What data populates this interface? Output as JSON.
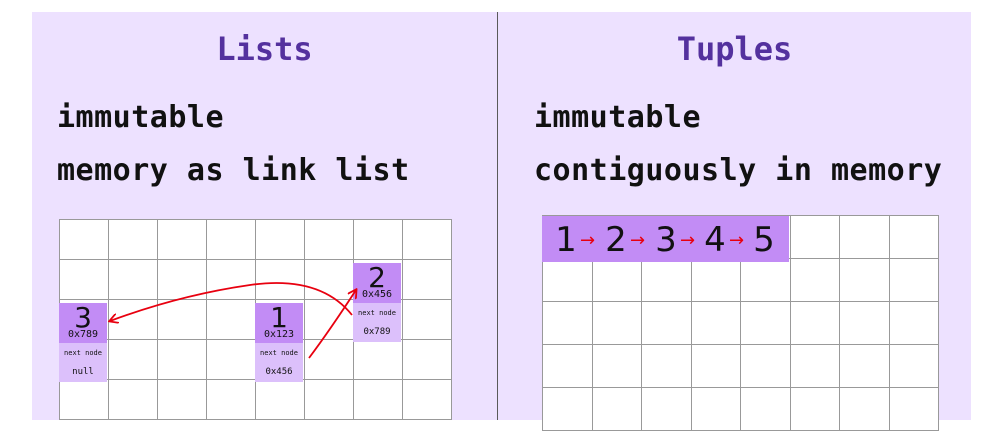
{
  "lists": {
    "title": "Lists",
    "line1": "immutable",
    "line2": "memory as link list",
    "nodes": [
      {
        "value": "3",
        "address": "0x789",
        "next_label": "next node",
        "next": "null"
      },
      {
        "value": "1",
        "address": "0x123",
        "next_label": "next node",
        "next": "0x456"
      },
      {
        "value": "2",
        "address": "0x456",
        "next_label": "next node",
        "next": "0x789"
      }
    ]
  },
  "tuples": {
    "title": "Tuples",
    "line1": "immutable",
    "line2": "contiguously in memory",
    "items": [
      "1",
      "2",
      "3",
      "4",
      "5"
    ],
    "arrow": "→"
  },
  "colors": {
    "panel_bg": "#ede1ff",
    "title": "#54319e",
    "node_dark": "#c28cf5",
    "node_light": "#dcc0fb",
    "arrow": "#e8000f"
  }
}
